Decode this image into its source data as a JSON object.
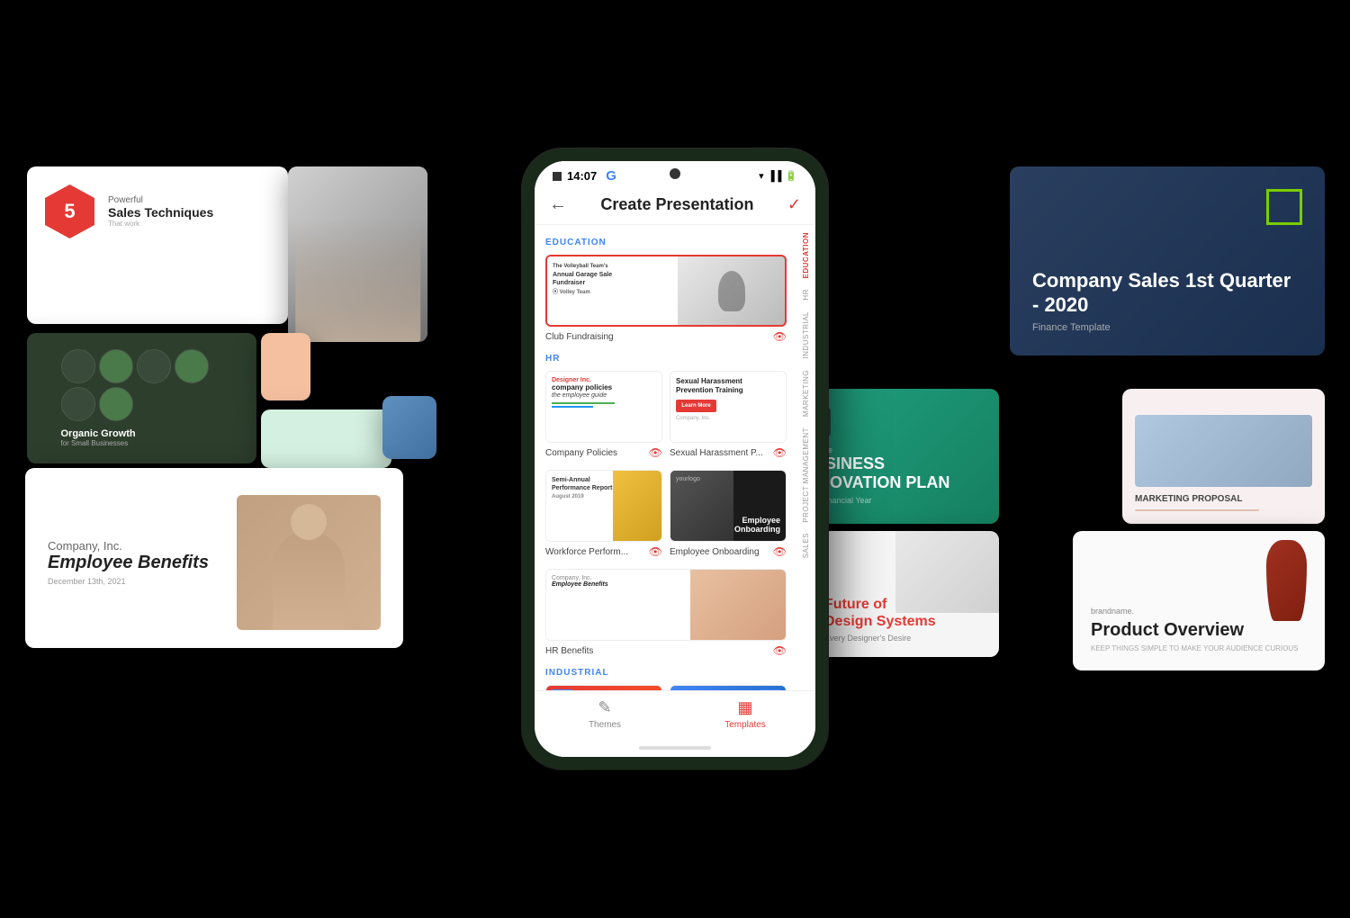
{
  "app": {
    "status_time": "14:07",
    "status_google": "G",
    "header_title": "Create Presentation",
    "check_icon": "✓",
    "back_icon": "←"
  },
  "sections": [
    {
      "id": "education",
      "label": "EDUCATION",
      "templates": [
        {
          "name": "Club Fundraising",
          "selected": true,
          "has_eye": true,
          "new_badge": false
        }
      ]
    },
    {
      "id": "hr",
      "label": "HR",
      "templates": [
        {
          "name": "Company Policies",
          "has_eye": true,
          "new_badge": false
        },
        {
          "name": "Sexual Harassment P...",
          "has_eye": true,
          "new_badge": false
        },
        {
          "name": "Workforce Perform...",
          "has_eye": true,
          "new_badge": false
        },
        {
          "name": "Employee Onboarding",
          "has_eye": true,
          "new_badge": false
        },
        {
          "name": "HR Benefits",
          "has_eye": true,
          "new_badge": false
        }
      ]
    },
    {
      "id": "industrial",
      "label": "INDUSTRIAL",
      "templates": [
        {
          "name": "",
          "has_eye": false,
          "new_badge": true
        },
        {
          "name": "",
          "has_eye": false,
          "new_badge": false
        }
      ]
    }
  ],
  "side_nav": [
    {
      "label": "EDUCATION",
      "active": true
    },
    {
      "label": "HR",
      "active": false
    },
    {
      "label": "INDUSTRIAL",
      "active": false
    },
    {
      "label": "MARKETING",
      "active": false
    },
    {
      "label": "PROJECT MANAGEMENT",
      "active": false
    },
    {
      "label": "SALES",
      "active": false
    }
  ],
  "tabs": [
    {
      "label": "Themes",
      "icon": "✎",
      "active": false
    },
    {
      "label": "Templates",
      "icon": "▦",
      "active": true
    }
  ],
  "bg_cards": {
    "sales_techniques": {
      "number": "5",
      "title": "Sales Techniques",
      "subtitle": "Powerful",
      "tagline": "That work"
    },
    "organic_growth": {
      "title": "Organic Growth",
      "subtitle": "for Small Businesses"
    },
    "employee_benefits": {
      "company": "Company, Inc.",
      "title": "Employee Benefits",
      "date": "December 13th, 2021"
    },
    "company_sales": {
      "title": "Company Sales 1st Quarter - 2020",
      "subtitle": "Finance Template"
    },
    "business_innovation": {
      "tagline": "Tag Line",
      "title": "BUSINESS INNOVATION PLAN",
      "year": "Next Financial Year"
    },
    "marketing_proposal": {
      "title": "MARKETING PROPOSAL"
    },
    "design_systems": {
      "title_line1": "Future of",
      "title_line2": "Design Systems",
      "subtitle": "Every Designer's Desire"
    },
    "product_overview": {
      "brand": "brandname.",
      "title": "Product Overview",
      "subtitle": "KEEP THINGS SIMPLE TO MAKE YOUR AUDIENCE CURIOUS"
    }
  },
  "colors": {
    "accent_red": "#e53935",
    "accent_blue": "#4285f4",
    "accent_green": "#20a080"
  }
}
